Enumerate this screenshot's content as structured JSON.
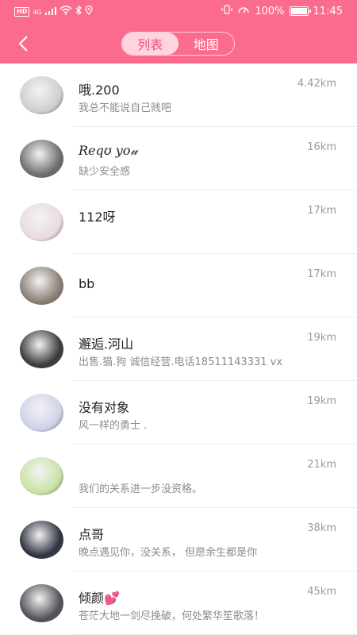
{
  "status_bar": {
    "hd": "HD",
    "net": "4G",
    "battery_percent": "100%",
    "battery_level": 1.0,
    "time": "11:45"
  },
  "header": {
    "tabs": [
      {
        "label": "列表",
        "active": true
      },
      {
        "label": "地图",
        "active": false
      }
    ],
    "bg_color": "#fb6b8d",
    "active_tab_bg": "#ffd4df",
    "active_tab_text": "#f0507a"
  },
  "users": [
    {
      "name": "哦.200",
      "signature": "我总不能说自己贱吧",
      "distance": "4.42km",
      "avatar_color": "#cfcfcf"
    },
    {
      "name": "Reqʊ yo𝓊",
      "signature": "缺少安全感",
      "distance": "16km",
      "avatar_color": "#6e6e6e"
    },
    {
      "name": "112呀",
      "signature": "",
      "distance": "17km",
      "avatar_color": "#e9dbe0"
    },
    {
      "name": "bb",
      "signature": "",
      "distance": "17km",
      "avatar_color": "#8a7f74"
    },
    {
      "name": "邂逅.河山",
      "signature": "出售.猫.狗  诚信经营.电话18511143331 vx",
      "distance": "19km",
      "avatar_color": "#3a3a3a"
    },
    {
      "name": "没有对象",
      "signature": "风一样的勇士 .",
      "distance": "19km",
      "avatar_color": "#cfd3ea"
    },
    {
      "name": "",
      "signature": "我们的关系进一步没资格。",
      "distance": "21km",
      "avatar_color": "#c9e3a7"
    },
    {
      "name": " 点哥",
      "signature": "晚点遇见你，没关系，  但愿余生都是你",
      "distance": "38km",
      "avatar_color": "#2f3240"
    },
    {
      "name": " 倾颜💕",
      "signature": "苍茫大地一剑尽挽破，何处繁华笙歌落！",
      "distance": "45km",
      "avatar_color": "#55505a"
    }
  ]
}
